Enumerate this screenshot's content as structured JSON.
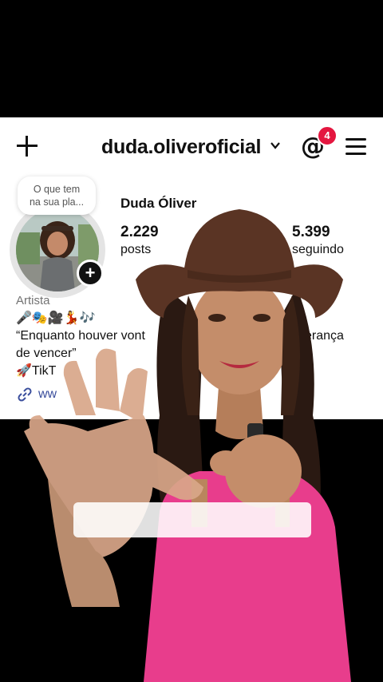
{
  "header": {
    "username": "duda.oliveroficial",
    "notification_count": "4"
  },
  "note": {
    "text_line1": "O que tem",
    "text_line2": "na sua pla..."
  },
  "profile": {
    "display_name": "Duda Óliver",
    "stats": [
      {
        "value": "2.229",
        "label": "posts"
      },
      {
        "value": "5.399",
        "label": "seguindo"
      }
    ],
    "category": "Artista",
    "bio_lines": [
      "🎤🎭🎥💃🎶",
      "“Enquanto houver vont",
      "de vencer”",
      "🚀TikT"
    ],
    "bio_line1_tail": "erança",
    "link_text": "ww"
  },
  "icons": {
    "plus": "plus-icon",
    "chevron": "chevron-down-icon",
    "threads": "threads-icon",
    "menu": "hamburger-menu-icon",
    "link": "link-icon"
  },
  "colors": {
    "hat": "#5a3424",
    "dress": "#e83d8c",
    "badge": "#e4163f",
    "link": "#3b4f9d"
  }
}
